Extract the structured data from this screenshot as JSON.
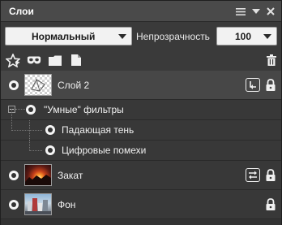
{
  "panel": {
    "title": "Слои"
  },
  "controls": {
    "blend_mode": "Нормальный",
    "opacity_label": "Непрозрачность",
    "opacity_value": "100"
  },
  "toolbar": {
    "icons": [
      "star-icon",
      "mask-icon",
      "folder-icon",
      "new-layer-icon",
      "trash-icon"
    ]
  },
  "layers": [
    {
      "name": "Слой 2",
      "selected": true,
      "badge": "smart-filter",
      "locked": true
    },
    {
      "name": "\"Умные\" фильтры",
      "type": "group"
    },
    {
      "name": "Падающая тень",
      "type": "filter"
    },
    {
      "name": "Цифровые помехи",
      "type": "filter"
    },
    {
      "name": "Закат",
      "badge": "link",
      "locked": true
    },
    {
      "name": "Фон",
      "locked": true
    }
  ],
  "colors": {
    "panel_bg": "#3a3a3a",
    "titlebar_bg": "#4a4a4a",
    "selected_row": "#474747",
    "text": "#f0f0f0"
  }
}
